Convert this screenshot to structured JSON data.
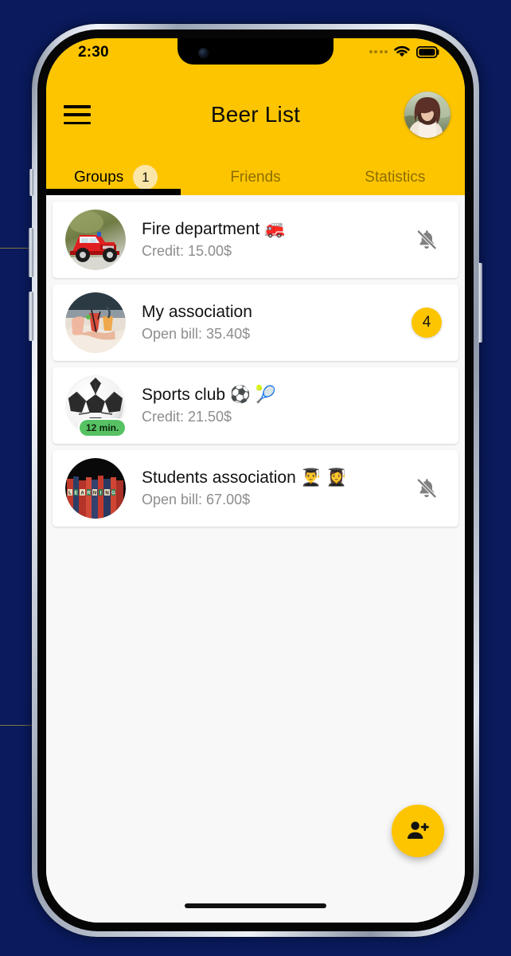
{
  "device": {
    "status_bar": {
      "time": "2:30",
      "signal_icon": "signal-dots-icon",
      "wifi_icon": "wifi-icon",
      "battery_icon": "battery-full-icon"
    },
    "home_indicator": "home-indicator"
  },
  "header": {
    "menu_icon": "hamburger-menu-icon",
    "title": "Beer List",
    "avatar": "profile-avatar",
    "background_color": "#FDC500"
  },
  "tabs": {
    "active_index": 0,
    "items": [
      {
        "label": "Groups",
        "badge": "1"
      },
      {
        "label": "Friends",
        "badge": null
      },
      {
        "label": "Statistics",
        "badge": null
      }
    ]
  },
  "groups": [
    {
      "name": "Fire department 🚒",
      "detail": "Credit: 15.00$",
      "avatar_icon": "fire-truck-avatar",
      "trailing": "bell-off-icon",
      "badge": null,
      "time_chip": null
    },
    {
      "name": "My association",
      "detail": "Open bill: 35.40$",
      "avatar_icon": "cocktails-avatar",
      "trailing": "count-badge",
      "badge": "4",
      "time_chip": null
    },
    {
      "name": "Sports club ⚽ 🎾",
      "detail": "Credit: 21.50$",
      "avatar_icon": "soccer-ball-avatar",
      "trailing": null,
      "badge": null,
      "time_chip": "12 min."
    },
    {
      "name": "Students association 👨‍🎓 👩‍🎓",
      "detail": "Open bill: 67.00$",
      "avatar_icon": "books-learning-avatar",
      "trailing": "bell-off-icon",
      "badge": null,
      "time_chip": null
    }
  ],
  "fab": {
    "icon": "add-person-icon",
    "color": "#FDC500"
  },
  "colors": {
    "page_background": "#0A1A5C",
    "accent_yellow": "#FDC500",
    "tab_badge": "#FAE6A8",
    "time_chip_green": "#56C263",
    "list_background": "#F8F8F8",
    "card_background": "#FFFFFF"
  }
}
